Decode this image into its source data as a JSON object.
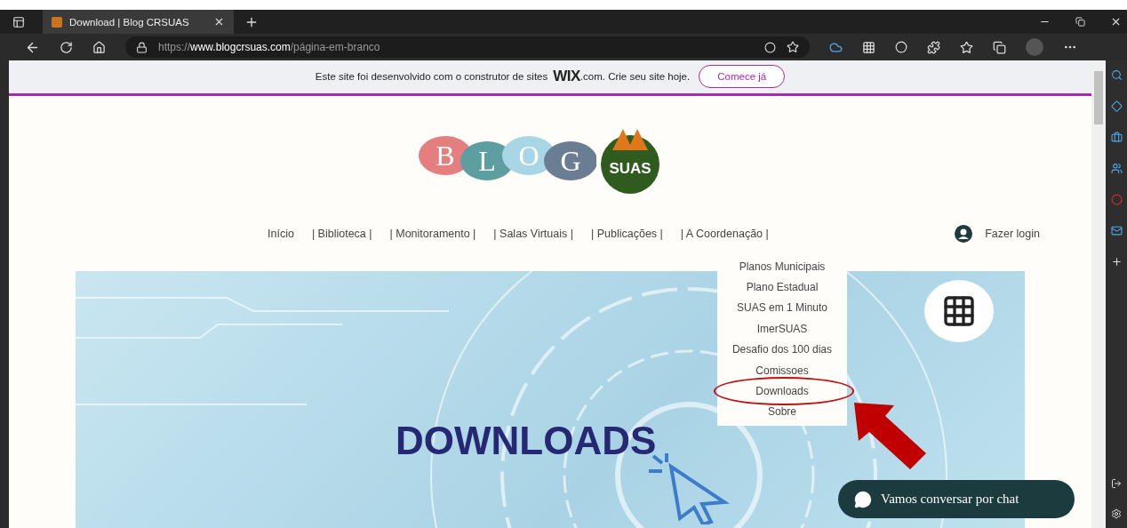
{
  "browser": {
    "tab": {
      "title": "Download | Blog CRSUAS"
    },
    "url": {
      "scheme": "https://",
      "host": "www.blogcrsuas.com",
      "path": "/página-em-branco"
    }
  },
  "banner": {
    "text": "Este site foi desenvolvido com o construtor de sites",
    "brand": "WIX",
    "after": ".com. Crie seu site hoje.",
    "button": "Comece já"
  },
  "logo": {
    "letters": [
      {
        "letter": "B",
        "color": "#e57f7f"
      },
      {
        "letter": "L",
        "color": "#5d9ea0"
      },
      {
        "letter": "O",
        "color": "#a9d6e5"
      },
      {
        "letter": "G",
        "color": "#6b7d93"
      }
    ],
    "badge": "SUAS"
  },
  "nav": {
    "items": [
      "Início",
      "| Biblioteca |",
      "| Monitoramento |",
      "| Salas Virtuais |",
      "| Publicações |",
      "| A Coordenação |"
    ],
    "login": "Fazer login"
  },
  "dropdown": [
    {
      "label": "Planos Municipais",
      "circled": false
    },
    {
      "label": "Plano Estadual",
      "circled": false
    },
    {
      "label": "SUAS em 1 Minuto",
      "circled": false
    },
    {
      "label": "ImerSUAS",
      "circled": false
    },
    {
      "label": "Desafio dos 100 dias",
      "circled": false
    },
    {
      "label": "Comissoes",
      "circled": false
    },
    {
      "label": "Downloads",
      "circled": true
    },
    {
      "label": "Sobre",
      "circled": false
    }
  ],
  "hero": {
    "title": "DOWNLOADS"
  },
  "chat": {
    "label": "Vamos conversar por chat"
  }
}
